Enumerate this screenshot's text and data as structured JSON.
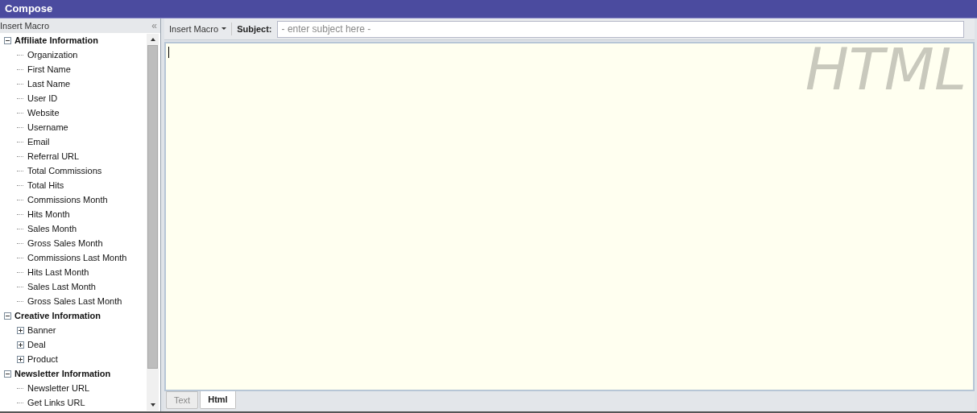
{
  "window": {
    "title": "Compose"
  },
  "sidebar": {
    "title": "Insert Macro",
    "collapse_glyph": "«",
    "tree": [
      {
        "label": "Affiliate Information",
        "expanded": true,
        "children": [
          {
            "label": "Organization"
          },
          {
            "label": "First Name"
          },
          {
            "label": "Last Name"
          },
          {
            "label": "User ID"
          },
          {
            "label": "Website"
          },
          {
            "label": "Username"
          },
          {
            "label": "Email"
          },
          {
            "label": "Referral URL"
          },
          {
            "label": "Total Commissions"
          },
          {
            "label": "Total Hits"
          },
          {
            "label": "Commissions Month"
          },
          {
            "label": "Hits Month"
          },
          {
            "label": "Sales Month"
          },
          {
            "label": "Gross Sales Month"
          },
          {
            "label": "Commissions Last Month"
          },
          {
            "label": "Hits Last Month"
          },
          {
            "label": "Sales Last Month"
          },
          {
            "label": "Gross Sales Last Month"
          }
        ]
      },
      {
        "label": "Creative Information",
        "expanded": true,
        "children": [
          {
            "label": "Banner",
            "expanded": false
          },
          {
            "label": "Deal",
            "expanded": false
          },
          {
            "label": "Product",
            "expanded": false
          }
        ]
      },
      {
        "label": "Newsletter Information",
        "expanded": true,
        "children": [
          {
            "label": "Newsletter URL"
          },
          {
            "label": "Get Links URL"
          }
        ]
      }
    ]
  },
  "toolbar": {
    "insert_macro": "Insert Macro",
    "subject_label": "Subject:",
    "subject_placeholder": "- enter subject here -"
  },
  "editor": {
    "mode_mark": "HTML"
  },
  "tabs": [
    {
      "label": "Text",
      "selected": false
    },
    {
      "label": "Html",
      "selected": true
    }
  ]
}
